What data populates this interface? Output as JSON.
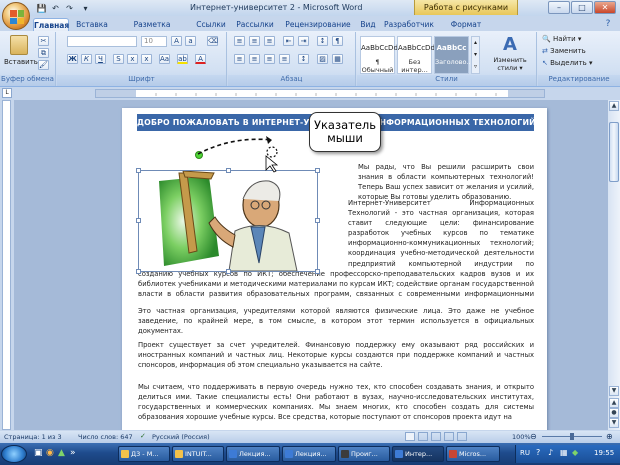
{
  "window": {
    "title": "Интернет-университет 2 - Microsoft Word",
    "context_tab": "Работа с рисунками",
    "minimize": "–",
    "maximize": "□",
    "close": "✕"
  },
  "tabs": [
    {
      "label": "Главная",
      "active": true
    },
    {
      "label": "Вставка"
    },
    {
      "label": "Разметка страницы"
    },
    {
      "label": "Ссылки"
    },
    {
      "label": "Рассылки"
    },
    {
      "label": "Рецензирование"
    },
    {
      "label": "Вид"
    },
    {
      "label": "Разработчик"
    },
    {
      "label": "Формат"
    }
  ],
  "ribbon": {
    "clipboard": {
      "paste": "Вставить",
      "label": "Буфер обмена"
    },
    "font": {
      "size": "10",
      "label": "Шрифт",
      "bold": "Ж",
      "italic": "К",
      "underline": "Ч"
    },
    "paragraph": {
      "label": "Абзац"
    },
    "styles": {
      "label": "Стили",
      "items": [
        {
          "preview": "AaBbCcDdI",
          "name": "¶ Обычный"
        },
        {
          "preview": "AaBbCcDdI",
          "name": "Без интер..."
        },
        {
          "preview": "AaBbCc",
          "name": "Заголово..."
        }
      ],
      "change": "Изменить стили ▾"
    },
    "editing": {
      "label": "Редактирование",
      "find": "Найти ▾",
      "replace": "Заменить",
      "select": "Выделить ▾"
    }
  },
  "document": {
    "banner": "ДОБРО ПОЖАЛОВАТЬ В ИНТЕРНЕТ-УНИВЕРСИТЕТ ИНФОРМАЦИОННЫХ ТЕХНОЛОГИЙ!",
    "p1": "Мы рады, что Вы решили расширить свои знания в области компьютерных технологий! Теперь Ваш успех зависит от желания и усилий, которые Вы готовы уделить образованию.",
    "p2": "Интернет-Университет Информационных Технологий - это частная организация, которая ставит следующие цели: финансирование разработок учебных курсов по тематике информационно-коммуникационных технологий; координация учебно-методической деятельности предприятий компьютерной индустрии по созданию учебных курсов по ИКТ; обеспечение профессорско-преподавательских кадров вузов и их библиотек учебниками и методическими материалами по курсам ИКТ; содействие органам государственной власти в области развития образовательных программ, связанных с современными информационными технологиями.",
    "p3": "Это частная организация, учредителями которой являются физические лица. Это даже не учебное заведение, по крайней мере, в том смысле, в котором этот термин используется в официальных документах.",
    "p4": "Проект существует за счет учредителей. Финансовую поддержку ему оказывают ряд российских и иностранных компаний и частных лиц. Некоторые курсы создаются при поддержке компаний и частных спонсоров, информация об этом специально указывается на сайте.",
    "p5": "Мы считаем, что поддерживать в первую очередь нужно тех, кто способен создавать знания, и открыто делиться ими. Такие специалисты есть! Они работают в вузах, научно-исследовательских институтах, государственных и коммерческих компаниях. Мы знаем многих, кто способен создать для системы образования хорошие учебные курсы. Все средства, которые поступают от спонсоров проекта идут на"
  },
  "callout": {
    "text": "Указатель мыши"
  },
  "statusbar": {
    "page": "Страница: 1 из 3",
    "words": "Число слов: 647",
    "language": "Русский (Россия)",
    "zoom": "100%"
  },
  "taskbar": {
    "items": [
      {
        "label": "Д3 - М...",
        "color": "#f3c24a"
      },
      {
        "label": "INTUIT...",
        "color": "#f3c24a"
      },
      {
        "label": "Лекция...",
        "color": "#3d7bd6"
      },
      {
        "label": "Лекция...",
        "color": "#3d7bd6"
      },
      {
        "label": "Проиг...",
        "color": "#3c3c3c"
      },
      {
        "label": "Интер...",
        "color": "#3d7bd6",
        "active": true
      },
      {
        "label": "Micros...",
        "color": "#c74634"
      }
    ],
    "lang": "RU",
    "clock": "19:55"
  }
}
